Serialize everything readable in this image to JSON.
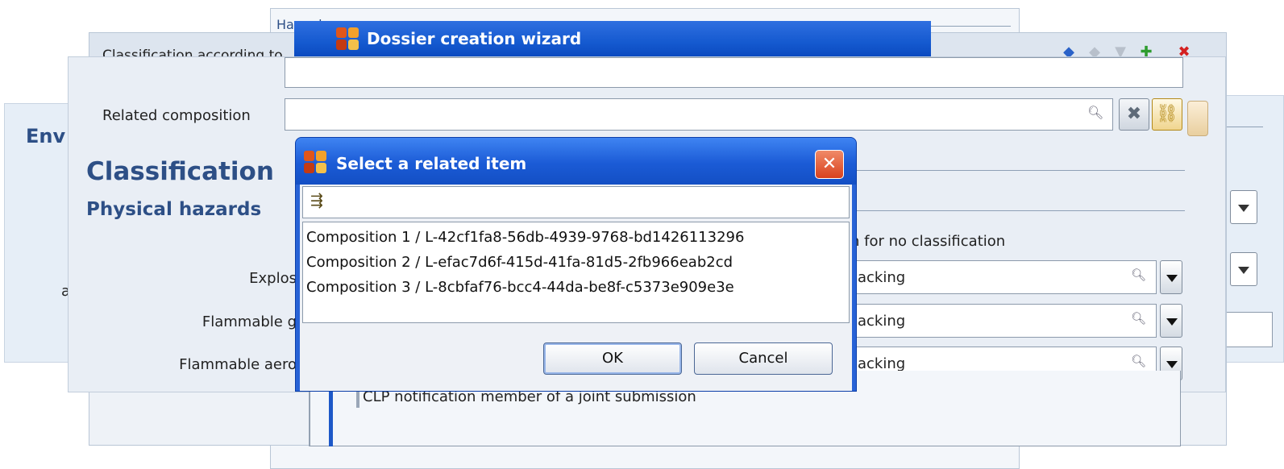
{
  "background": {
    "env_title": "Env",
    "env_a": "a",
    "hazard_tab": "Hazard",
    "clp_header": "Classification according to",
    "classification_title": "Classification",
    "physical_hazards_title": "Physical hazards",
    "related_composition_label": "Related composition",
    "reason_header": "n for no classification",
    "rows": [
      {
        "label": "Explos",
        "value": "acking"
      },
      {
        "label": "Flammable g",
        "value": "acking"
      },
      {
        "label": "Flammable aero",
        "value": "acking"
      }
    ],
    "clp_joint_text": "CLP notification member of a joint submission"
  },
  "wizard": {
    "title": "Dossier creation wizard"
  },
  "dialog": {
    "title": "Select a related item",
    "close_label": "✕",
    "items": [
      "Composition 1 / L-42cf1fa8-56db-4939-9768-bd1426113296",
      "Composition 2 / L-efac7d6f-415d-41fa-81d5-2fb966eab2cd",
      "Composition 3 / L-8cbfaf76-bcc4-44da-be8f-c5373e909e3e"
    ],
    "ok_label": "OK",
    "cancel_label": "Cancel"
  },
  "icons": {
    "filter": "filter-icon",
    "search": "search-icon",
    "clear": "clear-icon",
    "link": "link-icon",
    "close": "close-icon",
    "toolbar_delete": "delete-icon"
  },
  "colors": {
    "title_blue": "#2d4f86",
    "xp_titlebar": "#1b5bd6",
    "close_red": "#d9421e"
  }
}
